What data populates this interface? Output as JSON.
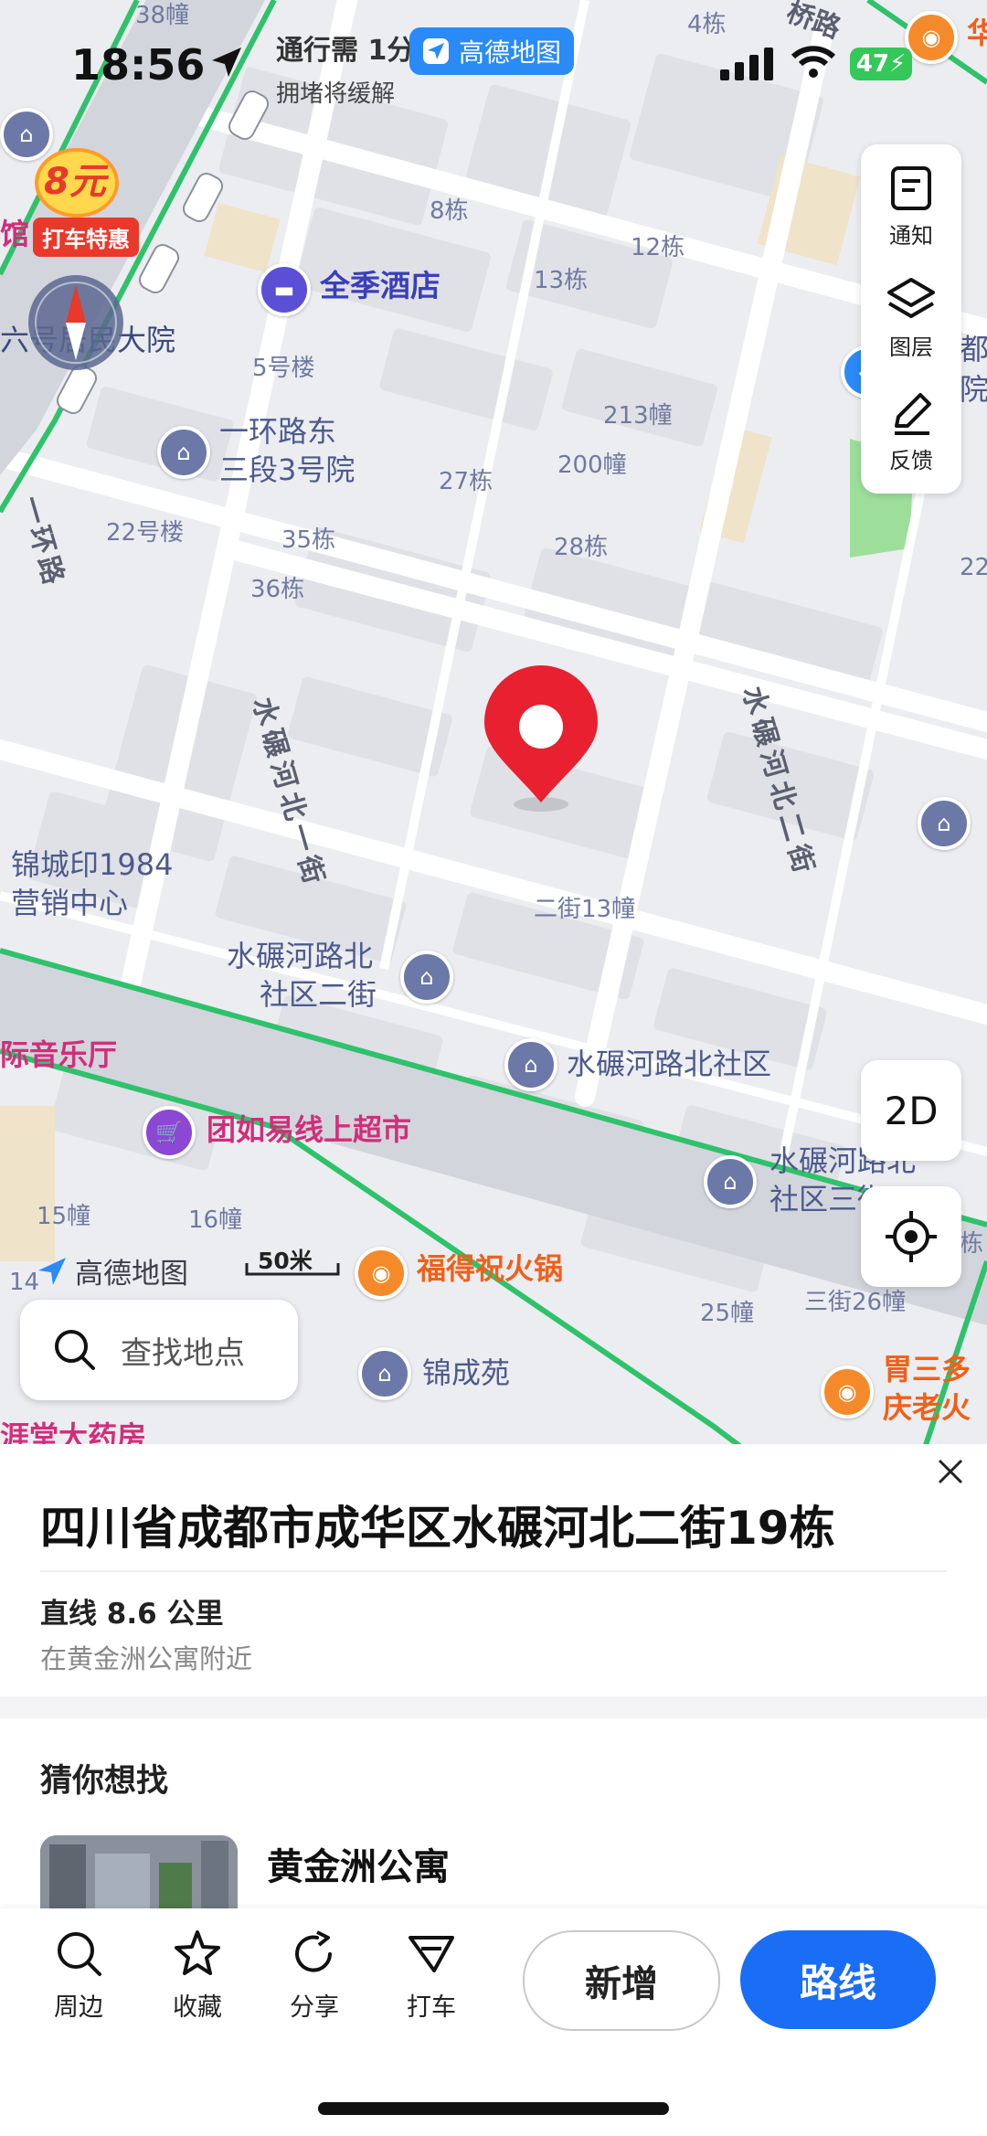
{
  "status": {
    "time": "18:56",
    "battery": "47",
    "nav_text": "通行需 1分",
    "nav_sub": "拥堵将缓解",
    "app_pill": "高德地图"
  },
  "promo": {
    "price": "8元",
    "label": "打车特惠"
  },
  "map_tools": {
    "notify": "通知",
    "layers": "图层",
    "feedback": "反馈",
    "mode_2d": "2D"
  },
  "map_labels": {
    "b38": "38幢",
    "b4": "4栋",
    "road_top": "桥路",
    "hua": "华",
    "b8": "8栋",
    "b12": "12栋",
    "b13": "13栋",
    "hotel": "全季酒店",
    "b5": "5号楼",
    "yard6": "六号居民大院",
    "ring_poi_1": "一环路东",
    "ring_poi_2": "三段3号院",
    "b27": "27栋",
    "b213": "213幢",
    "b200": "200幢",
    "b22": "22号楼",
    "b35": "35栋",
    "b28": "28栋",
    "b36": "36栋",
    "road_1": "水碾河北一街",
    "road_2": "水碾河北二街",
    "ring": "一环路",
    "jincheng_1": "锦城印1984",
    "jincheng_2": "营销中心",
    "b2_13": "二街13幢",
    "sq_1": "水碾河路北",
    "sq_2": "社区二街",
    "sq_main": "水碾河路北社区",
    "music": "际音乐厅",
    "market": "团如易线上超市",
    "sq3_1": "水碾河路北",
    "sq3_2": "社区三街",
    "b15": "15幢",
    "b16": "16幢",
    "b14": "14",
    "hotpot": "福得祝火锅",
    "b25": "25幢",
    "b3_26": "三街26幢",
    "jcy": "锦成苑",
    "hotpot2_1": "胃三多",
    "hotpot2_2": "庆老火",
    "pharmacy": "涯堂大药房",
    "right_edge_1": "都市",
    "right_edge_2": "院学",
    "right_22": "22",
    "right_dong": "栋",
    "guan": "馆"
  },
  "watermark": "高德地图",
  "scale_label": "50米",
  "search": {
    "placeholder": "查找地点"
  },
  "sheet": {
    "address": "四川省成都市成华区水碾河北二街19栋",
    "distance": "直线 8.6 公里",
    "nearby": "在黄金洲公寓附近",
    "section_title": "猜你想找",
    "suggestion_title": "黄金洲公寓"
  },
  "actions": {
    "nearby": "周边",
    "favorite": "收藏",
    "share": "分享",
    "taxi": "打车",
    "add": "新增",
    "route": "路线"
  },
  "colors": {
    "map_bg": "#ecedf1",
    "road_green": "#2fc26b",
    "pin_red": "#e8202f",
    "route_blue": "#1a6df5",
    "pink_poi": "#d12e7a",
    "orange_poi": "#f0601a"
  }
}
